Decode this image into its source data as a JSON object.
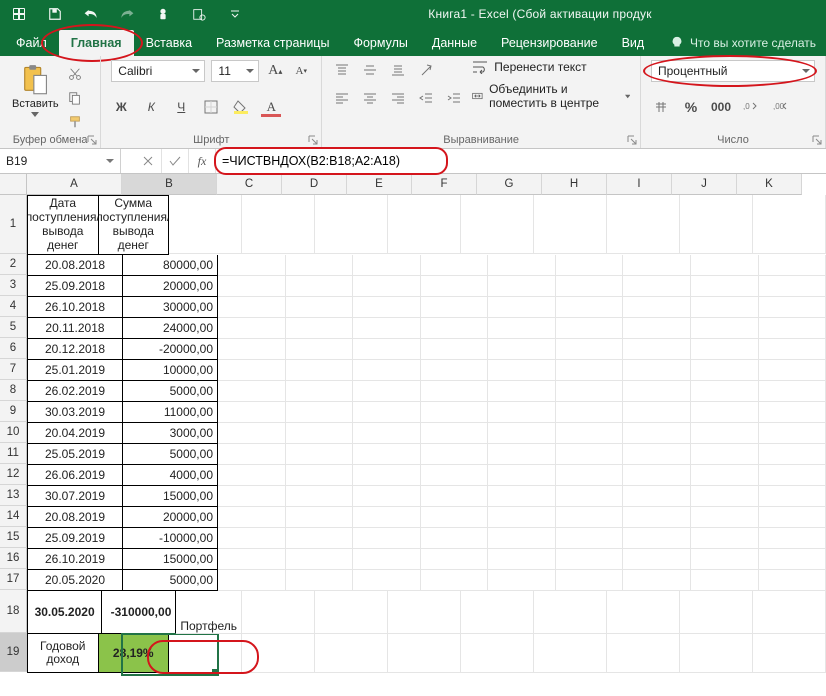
{
  "titlebar": {
    "title": "Книга1 - Excel (Сбой активации продук"
  },
  "tabs": {
    "file": "Файл",
    "home": "Главная",
    "insert": "Вставка",
    "layout": "Разметка страницы",
    "formulas": "Формулы",
    "data": "Данные",
    "review": "Рецензирование",
    "view": "Вид",
    "tell_me": "Что вы хотите сделать"
  },
  "ribbon": {
    "paste": "Вставить",
    "clipboard_group": "Буфер обмена",
    "font": "Calibri",
    "size": "11",
    "font_group": "Шрифт",
    "align_group": "Выравнивание",
    "wrap": "Перенести текст",
    "merge": "Объединить и поместить в центре",
    "number_format": "Процентный",
    "number_group": "Число"
  },
  "namebox": "B19",
  "formula": "=ЧИСТВНДОХ(B2:B18;A2:A18)",
  "columns": [
    "A",
    "B",
    "C",
    "D",
    "E",
    "F",
    "G",
    "H",
    "I",
    "J",
    "K"
  ],
  "headers": {
    "A": "Дата поступления/вывода денег",
    "B": "Сумма поступления/вывода денег"
  },
  "rows": [
    {
      "n": 2,
      "a": "20.08.2018",
      "b": "80000,00"
    },
    {
      "n": 3,
      "a": "25.09.2018",
      "b": "20000,00"
    },
    {
      "n": 4,
      "a": "26.10.2018",
      "b": "30000,00"
    },
    {
      "n": 5,
      "a": "20.11.2018",
      "b": "24000,00"
    },
    {
      "n": 6,
      "a": "20.12.2018",
      "b": "-20000,00"
    },
    {
      "n": 7,
      "a": "25.01.2019",
      "b": "10000,00"
    },
    {
      "n": 8,
      "a": "26.02.2019",
      "b": "5000,00"
    },
    {
      "n": 9,
      "a": "30.03.2019",
      "b": "11000,00"
    },
    {
      "n": 10,
      "a": "20.04.2019",
      "b": "3000,00"
    },
    {
      "n": 11,
      "a": "25.05.2019",
      "b": "5000,00"
    },
    {
      "n": 12,
      "a": "26.06.2019",
      "b": "4000,00"
    },
    {
      "n": 13,
      "a": "30.07.2019",
      "b": "15000,00"
    },
    {
      "n": 14,
      "a": "20.08.2019",
      "b": "20000,00"
    },
    {
      "n": 15,
      "a": "25.09.2019",
      "b": "-10000,00"
    },
    {
      "n": 16,
      "a": "26.10.2019",
      "b": "15000,00"
    },
    {
      "n": 17,
      "a": "20.05.2020",
      "b": "5000,00"
    }
  ],
  "row18": {
    "a": "30.05.2020",
    "b": "-310000,00",
    "c": "Портфель"
  },
  "row19": {
    "a": "Годовой доход",
    "b": "28,19%"
  }
}
